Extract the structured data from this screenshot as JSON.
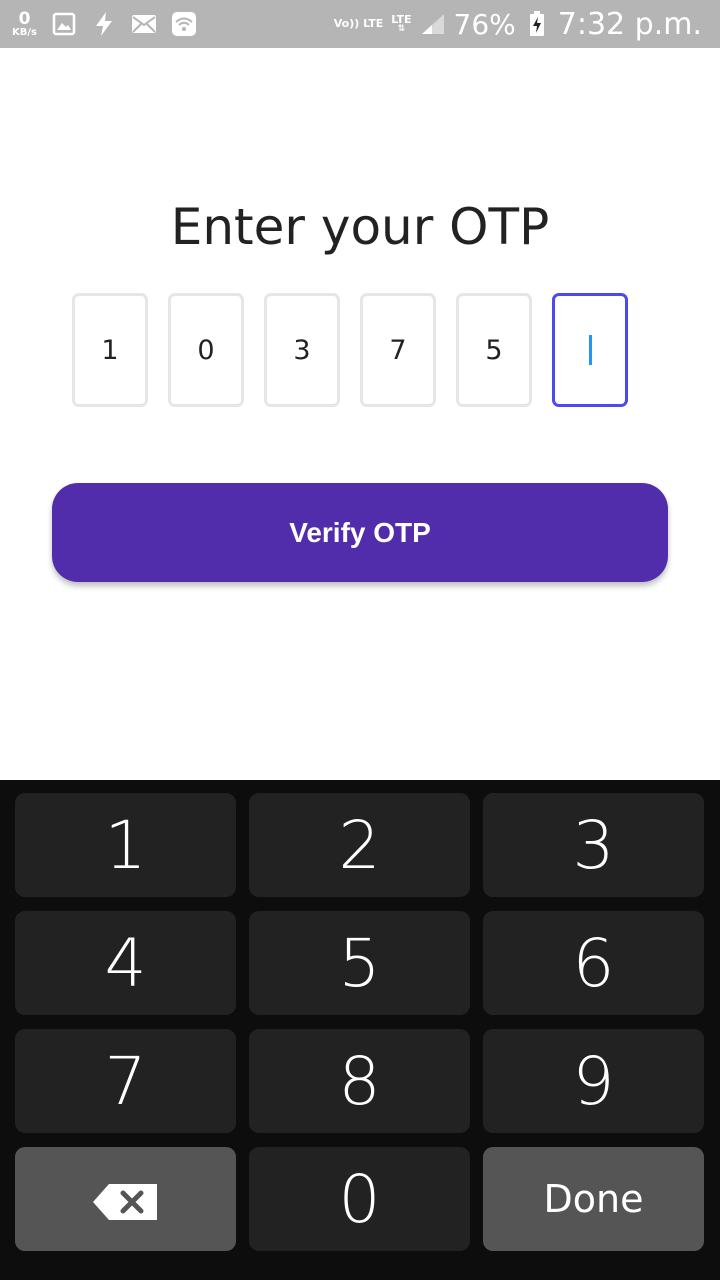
{
  "status_bar": {
    "data_speed_value": "0",
    "data_speed_unit": "KB/s",
    "volte_label": "Vo)) LTE",
    "lte_label": "LTE",
    "battery": "76%",
    "time": "7:32 p.m.",
    "icons": [
      "image-icon",
      "flash-icon",
      "mail-icon",
      "wifi-icon",
      "signal-icon",
      "battery-charging-icon"
    ]
  },
  "page": {
    "title": "Enter your OTP",
    "otp_digits": [
      "1",
      "0",
      "3",
      "7",
      "5",
      ""
    ],
    "active_index": 5,
    "verify_label": "Verify OTP",
    "accent_color": "#522dab",
    "active_border_color": "#4d49f2"
  },
  "keyboard": {
    "keys": [
      "1",
      "2",
      "3",
      "4",
      "5",
      "6",
      "7",
      "8",
      "9",
      "0"
    ],
    "backspace_icon": "backspace-icon",
    "done_label": "Done"
  }
}
